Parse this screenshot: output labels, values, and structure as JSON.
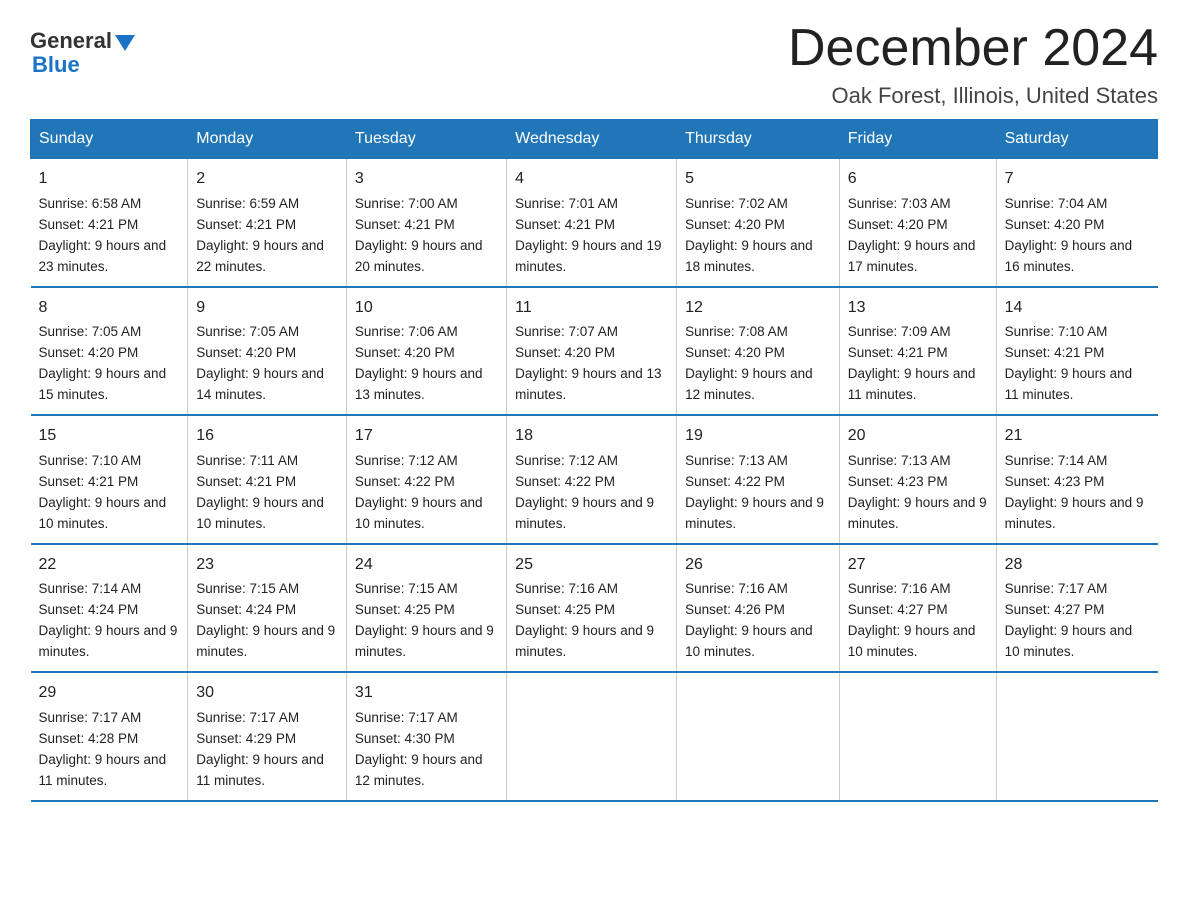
{
  "header": {
    "logo_general": "General",
    "logo_blue": "Blue",
    "title": "December 2024",
    "subtitle": "Oak Forest, Illinois, United States"
  },
  "weekdays": [
    "Sunday",
    "Monday",
    "Tuesday",
    "Wednesday",
    "Thursday",
    "Friday",
    "Saturday"
  ],
  "weeks": [
    [
      {
        "day": "1",
        "sunrise": "6:58 AM",
        "sunset": "4:21 PM",
        "daylight": "9 hours and 23 minutes."
      },
      {
        "day": "2",
        "sunrise": "6:59 AM",
        "sunset": "4:21 PM",
        "daylight": "9 hours and 22 minutes."
      },
      {
        "day": "3",
        "sunrise": "7:00 AM",
        "sunset": "4:21 PM",
        "daylight": "9 hours and 20 minutes."
      },
      {
        "day": "4",
        "sunrise": "7:01 AM",
        "sunset": "4:21 PM",
        "daylight": "9 hours and 19 minutes."
      },
      {
        "day": "5",
        "sunrise": "7:02 AM",
        "sunset": "4:20 PM",
        "daylight": "9 hours and 18 minutes."
      },
      {
        "day": "6",
        "sunrise": "7:03 AM",
        "sunset": "4:20 PM",
        "daylight": "9 hours and 17 minutes."
      },
      {
        "day": "7",
        "sunrise": "7:04 AM",
        "sunset": "4:20 PM",
        "daylight": "9 hours and 16 minutes."
      }
    ],
    [
      {
        "day": "8",
        "sunrise": "7:05 AM",
        "sunset": "4:20 PM",
        "daylight": "9 hours and 15 minutes."
      },
      {
        "day": "9",
        "sunrise": "7:05 AM",
        "sunset": "4:20 PM",
        "daylight": "9 hours and 14 minutes."
      },
      {
        "day": "10",
        "sunrise": "7:06 AM",
        "sunset": "4:20 PM",
        "daylight": "9 hours and 13 minutes."
      },
      {
        "day": "11",
        "sunrise": "7:07 AM",
        "sunset": "4:20 PM",
        "daylight": "9 hours and 13 minutes."
      },
      {
        "day": "12",
        "sunrise": "7:08 AM",
        "sunset": "4:20 PM",
        "daylight": "9 hours and 12 minutes."
      },
      {
        "day": "13",
        "sunrise": "7:09 AM",
        "sunset": "4:21 PM",
        "daylight": "9 hours and 11 minutes."
      },
      {
        "day": "14",
        "sunrise": "7:10 AM",
        "sunset": "4:21 PM",
        "daylight": "9 hours and 11 minutes."
      }
    ],
    [
      {
        "day": "15",
        "sunrise": "7:10 AM",
        "sunset": "4:21 PM",
        "daylight": "9 hours and 10 minutes."
      },
      {
        "day": "16",
        "sunrise": "7:11 AM",
        "sunset": "4:21 PM",
        "daylight": "9 hours and 10 minutes."
      },
      {
        "day": "17",
        "sunrise": "7:12 AM",
        "sunset": "4:22 PM",
        "daylight": "9 hours and 10 minutes."
      },
      {
        "day": "18",
        "sunrise": "7:12 AM",
        "sunset": "4:22 PM",
        "daylight": "9 hours and 9 minutes."
      },
      {
        "day": "19",
        "sunrise": "7:13 AM",
        "sunset": "4:22 PM",
        "daylight": "9 hours and 9 minutes."
      },
      {
        "day": "20",
        "sunrise": "7:13 AM",
        "sunset": "4:23 PM",
        "daylight": "9 hours and 9 minutes."
      },
      {
        "day": "21",
        "sunrise": "7:14 AM",
        "sunset": "4:23 PM",
        "daylight": "9 hours and 9 minutes."
      }
    ],
    [
      {
        "day": "22",
        "sunrise": "7:14 AM",
        "sunset": "4:24 PM",
        "daylight": "9 hours and 9 minutes."
      },
      {
        "day": "23",
        "sunrise": "7:15 AM",
        "sunset": "4:24 PM",
        "daylight": "9 hours and 9 minutes."
      },
      {
        "day": "24",
        "sunrise": "7:15 AM",
        "sunset": "4:25 PM",
        "daylight": "9 hours and 9 minutes."
      },
      {
        "day": "25",
        "sunrise": "7:16 AM",
        "sunset": "4:25 PM",
        "daylight": "9 hours and 9 minutes."
      },
      {
        "day": "26",
        "sunrise": "7:16 AM",
        "sunset": "4:26 PM",
        "daylight": "9 hours and 10 minutes."
      },
      {
        "day": "27",
        "sunrise": "7:16 AM",
        "sunset": "4:27 PM",
        "daylight": "9 hours and 10 minutes."
      },
      {
        "day": "28",
        "sunrise": "7:17 AM",
        "sunset": "4:27 PM",
        "daylight": "9 hours and 10 minutes."
      }
    ],
    [
      {
        "day": "29",
        "sunrise": "7:17 AM",
        "sunset": "4:28 PM",
        "daylight": "9 hours and 11 minutes."
      },
      {
        "day": "30",
        "sunrise": "7:17 AM",
        "sunset": "4:29 PM",
        "daylight": "9 hours and 11 minutes."
      },
      {
        "day": "31",
        "sunrise": "7:17 AM",
        "sunset": "4:30 PM",
        "daylight": "9 hours and 12 minutes."
      },
      null,
      null,
      null,
      null
    ]
  ]
}
